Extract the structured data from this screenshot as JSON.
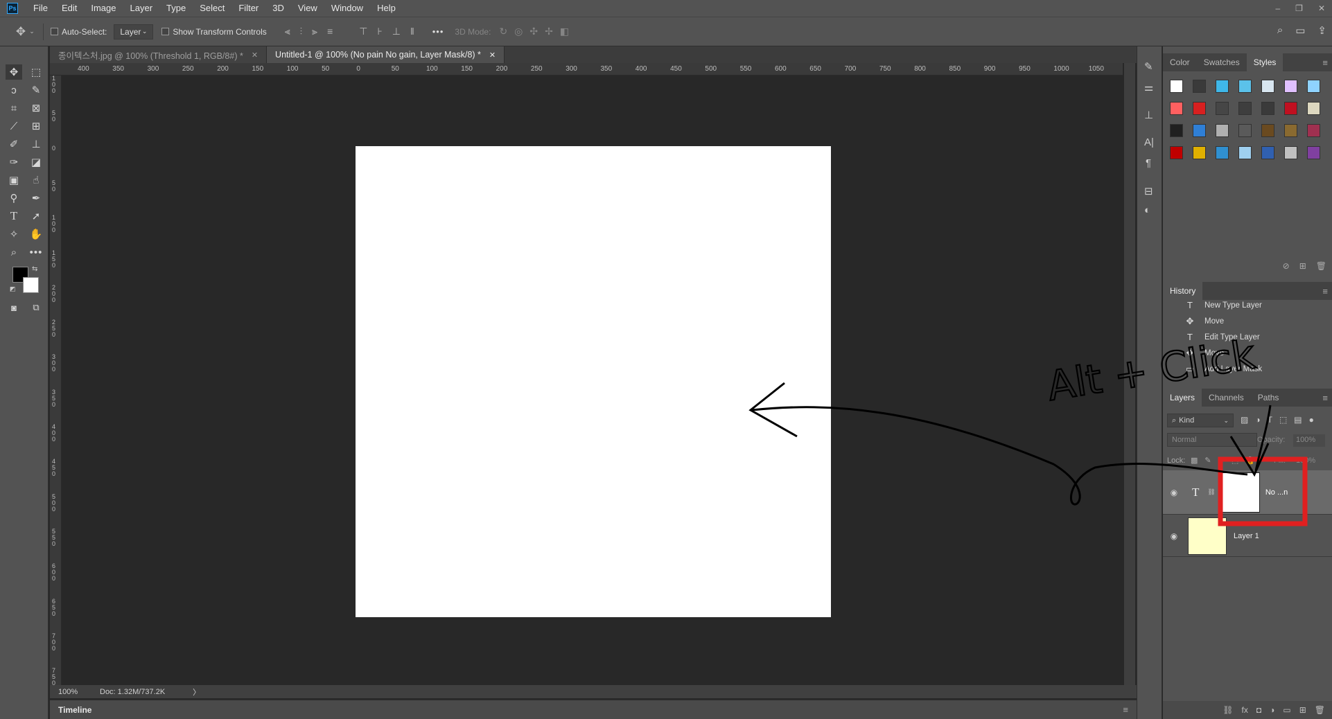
{
  "menubar": {
    "app_logo": "Ps",
    "items": [
      "File",
      "Edit",
      "Image",
      "Layer",
      "Type",
      "Select",
      "Filter",
      "3D",
      "View",
      "Window",
      "Help"
    ],
    "window_controls": [
      "–",
      "❐",
      "✕"
    ]
  },
  "options": {
    "auto_select_label": "Auto-Select:",
    "auto_select_value": "Layer",
    "transform_label": "Show Transform Controls",
    "mode_label": "3D Mode:",
    "more": "•••"
  },
  "tabs": [
    {
      "label": "종이텍스처.jpg @ 100% (Threshold 1, RGB/8#) *",
      "close": "✕",
      "active": false
    },
    {
      "label": "Untitled-1 @ 100% (No pain No gain, Layer Mask/8) *",
      "close": "✕",
      "active": true
    }
  ],
  "ruler": {
    "h_labels": [
      "400",
      "350",
      "300",
      "250",
      "200",
      "150",
      "100",
      "50",
      "0",
      "50",
      "100",
      "150",
      "200",
      "250",
      "300",
      "350",
      "400",
      "450",
      "500",
      "550",
      "600",
      "650",
      "700",
      "750",
      "800",
      "850",
      "900",
      "950",
      "1000",
      "1050"
    ],
    "v_labels": [
      "100",
      "50",
      "0",
      "50",
      "100",
      "150",
      "200",
      "250",
      "300",
      "350",
      "400",
      "450",
      "500",
      "550",
      "600",
      "650",
      "700",
      "750"
    ]
  },
  "status": {
    "zoom": "100%",
    "doc": "Doc: 1.32M/737.2K",
    "arrow": "〉"
  },
  "timeline": {
    "label": "Timeline"
  },
  "styles_panel": {
    "tabs": [
      "Color",
      "Swatches",
      "Styles"
    ],
    "active": "Styles",
    "swatch_colors": [
      [
        "#ffffff",
        "#3a3a3a",
        "#3fb7e8",
        "#5bc2ea",
        "#d8e6f0",
        "#e0c0ff",
        "#8fd3ff"
      ],
      [
        "#ff6060",
        "#d82020",
        "#464646",
        "#3e3e3e",
        "#3a3a3a",
        "#c01020",
        "#ddd8c0"
      ],
      [
        "#202020",
        "#2f7fd6",
        "#b0b0b0",
        "#5a5a5a",
        "#6a4a20",
        "#8a6a30",
        "#a03050"
      ],
      [
        "#c00000",
        "#e0b000",
        "#3090d0",
        "#9fd0f0",
        "#3060b0",
        "#c0c0c0",
        "#8040a0"
      ]
    ]
  },
  "history": {
    "title": "History",
    "items": [
      {
        "icon": "T",
        "label": "New Type Layer"
      },
      {
        "icon": "✥",
        "label": "Move"
      },
      {
        "icon": "T",
        "label": "Edit Type Layer"
      },
      {
        "icon": "✥",
        "label": "Move"
      },
      {
        "icon": "▭",
        "label": "Add Layer Mask"
      }
    ]
  },
  "layers": {
    "tabs": [
      "Layers",
      "Channels",
      "Paths"
    ],
    "active": "Layers",
    "filter_kind": "Kind",
    "blend_mode": "Normal",
    "opacity_label": "Opacity:",
    "opacity_value": "100%",
    "lock_label": "Lock:",
    "fill_label": "Fill:",
    "fill_value": "100%",
    "rows": [
      {
        "type_icon": "T",
        "name": "No ...n",
        "eye": "◉"
      },
      {
        "name": "Layer 1",
        "eye": "◉",
        "thumb_color": "#ffffc8"
      }
    ]
  },
  "annotation": {
    "handwriting": "Alt + Click",
    "highlight_color": "#e02020"
  }
}
